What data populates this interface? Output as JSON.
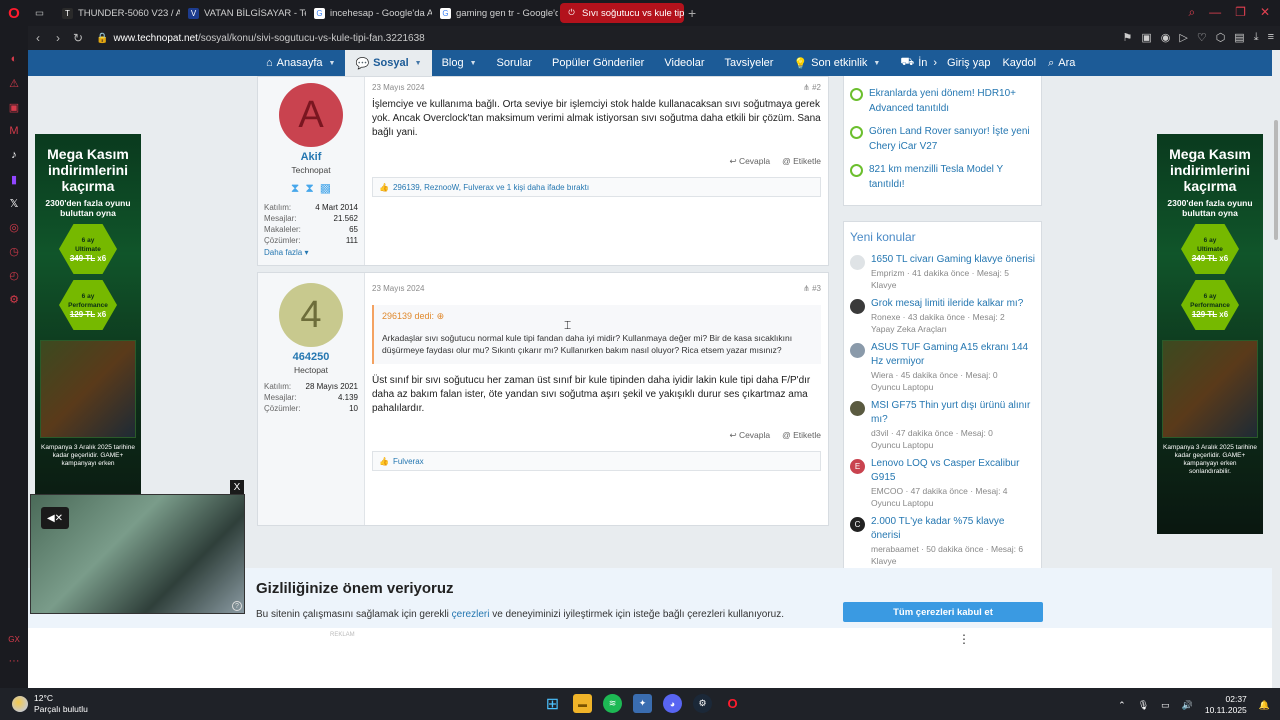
{
  "browser": {
    "tabs": [
      {
        "label": "THUNDER-5060 V23 / Am",
        "color": "#2a2a2a",
        "glyph": "T"
      },
      {
        "label": "VATAN BİLGİSAYAR - Tek",
        "color": "#1d3c8f",
        "glyph": "V"
      },
      {
        "label": "incehesap - Google'da Ar",
        "color": "#ffffff",
        "glyph": "G"
      },
      {
        "label": "gaming gen tr - Google'd",
        "color": "#ffffff",
        "glyph": "G"
      },
      {
        "label": "Sıvı soğutucu vs kule tipi",
        "color": "#b3121c",
        "glyph": "⏻"
      }
    ],
    "url_host": "www.technopat.net",
    "url_path": "/sosyal/konu/sivi-sogutucu-vs-kule-tipi-fan.3221638"
  },
  "site_nav": {
    "items": [
      "Anasayfa",
      "Sosyal",
      "Blog",
      "Sorular",
      "Popüler Gönderiler",
      "Videolar",
      "Tavsiyeler",
      "Son etkinlik",
      "İn"
    ],
    "login": "Giriş yap",
    "register": "Kaydol",
    "search": "Ara"
  },
  "ad": {
    "headline": "Mega Kasım indirimlerini kaçırma",
    "sub": "2300'den fazla oyunu buluttan oyna",
    "offer1": {
      "months": "6 ay",
      "tier": "Ultimate",
      "old": "349 TL",
      "mult": "x6"
    },
    "offer2": {
      "months": "6 ay",
      "tier": "Performance",
      "old": "129 TL",
      "mult": "x6"
    },
    "footer_left": "Kampanya 3 Aralık 2025 tarihine kadar geçerlidir. GAME+ kampanyayı erken",
    "footer_right": "Kampanya 3 Aralık 2025 tarihine kadar geçerlidir. GAME+ kampanyayı erken sonlandırabilir."
  },
  "posts": [
    {
      "avatar_letter": "A",
      "avatar_bg": "#c9434f",
      "avatar_fg": "#7a1620",
      "username": "Akif",
      "user_title": "Technopat",
      "stats": [
        [
          "Katılım:",
          "4 Mart 2014"
        ],
        [
          "Mesajlar:",
          "21.562"
        ],
        [
          "Makaleler:",
          "65"
        ],
        [
          "Çözümler:",
          "111"
        ]
      ],
      "more": "Daha fazla ▾",
      "date": "23 Mayıs 2024",
      "num": "#2",
      "text": "İşlemciye ve kullanıma bağlı. Orta seviye bir işlemciyi stok halde kullanacaksan sıvı soğutmaya gerek yok. Ancak Overclock'tan maksimum verimi almak istiyorsan sıvı soğutma daha etkili bir çözüm. Sana bağlı yani.",
      "reply": "Cevapla",
      "tag": "Etiketle",
      "reactions": "296139, ReznooW, Fulverax ve 1 kişi daha ifade bıraktı"
    },
    {
      "avatar_letter": "4",
      "avatar_bg": "#c8c98e",
      "avatar_fg": "#6d6d3a",
      "username": "464250",
      "user_title": "Hectopat",
      "stats": [
        [
          "Katılım:",
          "28 Mayıs 2021"
        ],
        [
          "Mesajlar:",
          "4.139"
        ],
        [
          "Çözümler:",
          "10"
        ]
      ],
      "date": "23 Mayıs 2024",
      "num": "#3",
      "quote_head": "296139 dedi:",
      "quote_body": "Arkadaşlar sıvı soğutucu normal kule tipi fandan daha iyi midir? Kullanmaya değer mi? Bir de kasa sıcaklıkını düşürmeye faydası olur mu? Sıkıntı çıkarır mı? Kullanırken bakım nasıl oluyor? Rica etsem yazar mısınız?",
      "text": "Üst sınıf bir sıvı soğutucu her zaman üst sınıf bir kule tipinden daha iyidir lakin kule tipi daha F/P'dır daha az bakım falan ister, öte yandan sıvı soğutma aşırı şekil ve yakışıklı durur ses çıkartmaz ama pahalılardır.",
      "reply": "Cevapla",
      "tag": "Etiketle",
      "reactions": "Fulverax"
    }
  ],
  "news": [
    "Ekranlarda yeni dönem! HDR10+ Advanced tanıtıldı",
    "Gören Land Rover sanıyor! İşte yeni Chery iCar V27",
    "821 km menzilli Tesla Model Y tanıtıldı!"
  ],
  "new_topics": {
    "title": "Yeni konular",
    "items": [
      {
        "title": "1650 TL civarı Gaming klavye önerisi",
        "meta": "Emprizm · 41 dakika önce · Mesaj: 5",
        "forum": "Klavye",
        "av": "#dfe3e6",
        "ch": ""
      },
      {
        "title": "Grok mesaj limiti ileride kalkar mı?",
        "meta": "Ronexe · 43 dakika önce · Mesaj: 2",
        "forum": "Yapay Zeka Araçları",
        "av": "#3a3a3a",
        "ch": ""
      },
      {
        "title": "ASUS TUF Gaming A15 ekranı 144 Hz vermiyor",
        "meta": "Wiera · 45 dakika önce · Mesaj: 0",
        "forum": "Oyuncu Laptopu",
        "av": "#8a9aaa",
        "ch": ""
      },
      {
        "title": "MSI GF75 Thin yurt dışı ürünü alınır mı?",
        "meta": "d3vil · 47 dakika önce · Mesaj: 0",
        "forum": "Oyuncu Laptopu",
        "av": "#5a5a40",
        "ch": ""
      },
      {
        "title": "Lenovo LOQ vs Casper Excalibur G915",
        "meta": "EMCOO · 47 dakika önce · Mesaj: 4",
        "forum": "Oyuncu Laptopu",
        "av": "#c9434f",
        "ch": "E"
      },
      {
        "title": "2.000 TL'ye kadar %75 klavye önerisi",
        "meta": "merabaamet · 50 dakika önce · Mesaj: 6",
        "forum": "Klavye",
        "av": "#222222",
        "ch": "C"
      }
    ]
  },
  "cookie": {
    "title": "Gizliliğinize önem veriyoruz",
    "desc_pre": "Bu sitenin çalışmasını sağlamak için gerekli ",
    "desc_link": "çerezleri",
    "desc_post": " ve deneyiminizi iyileştirmek için isteğe bağlı çerezleri kullanıyoruz.",
    "accept": "Tüm çerezleri kabul et",
    "reklam": "REKLAM"
  },
  "taskbar": {
    "temp": "12°C",
    "weather": "Parçalı bulutlu",
    "time": "02:37",
    "date": "10.11.2025"
  }
}
